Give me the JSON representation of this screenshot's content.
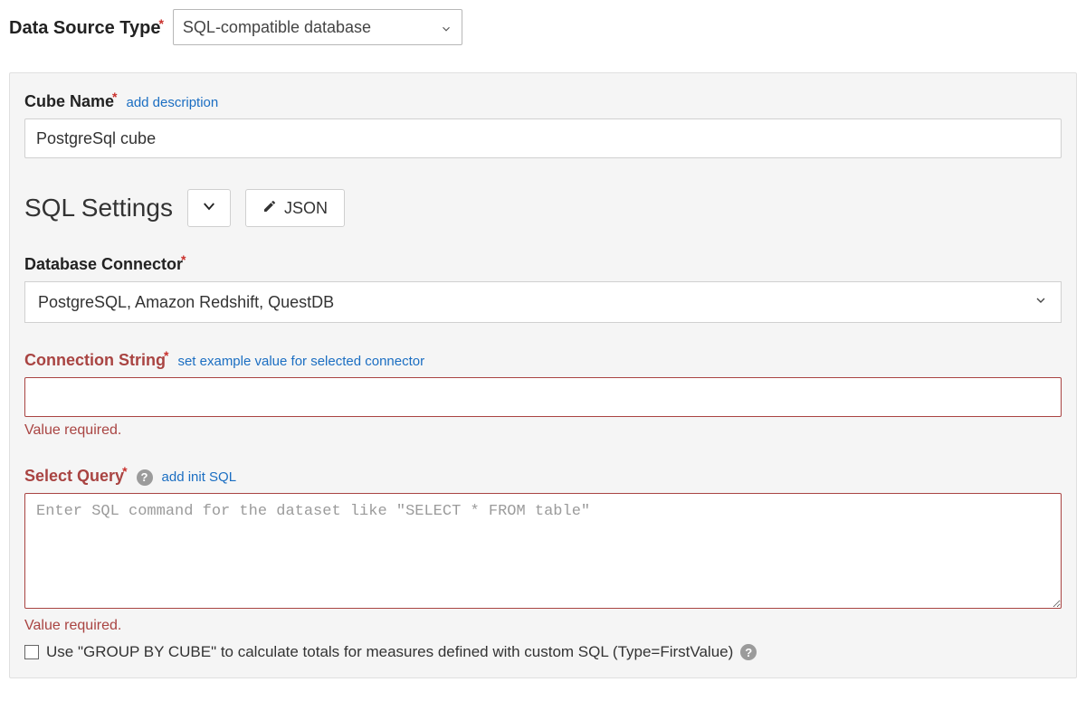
{
  "dataSourceType": {
    "label": "Data Source Type",
    "value": "SQL-compatible database"
  },
  "panel": {
    "cubeName": {
      "label": "Cube Name",
      "addDescriptionLink": "add description",
      "value": "PostgreSql cube"
    },
    "sqlSettings": {
      "heading": "SQL Settings",
      "jsonButton": "JSON"
    },
    "databaseConnector": {
      "label": "Database Connector",
      "value": "PostgreSQL, Amazon Redshift, QuestDB"
    },
    "connectionString": {
      "label": "Connection String",
      "exampleLink": "set example value for selected connector",
      "value": "",
      "error": "Value required."
    },
    "selectQuery": {
      "label": "Select Query",
      "addInitLink": "add init SQL",
      "placeholder": "Enter SQL command for the dataset like \"SELECT * FROM table\"",
      "value": "",
      "error": "Value required."
    },
    "groupByCube": {
      "label": "Use \"GROUP BY CUBE\" to calculate totals for measures defined with custom SQL (Type=FirstValue)"
    }
  }
}
